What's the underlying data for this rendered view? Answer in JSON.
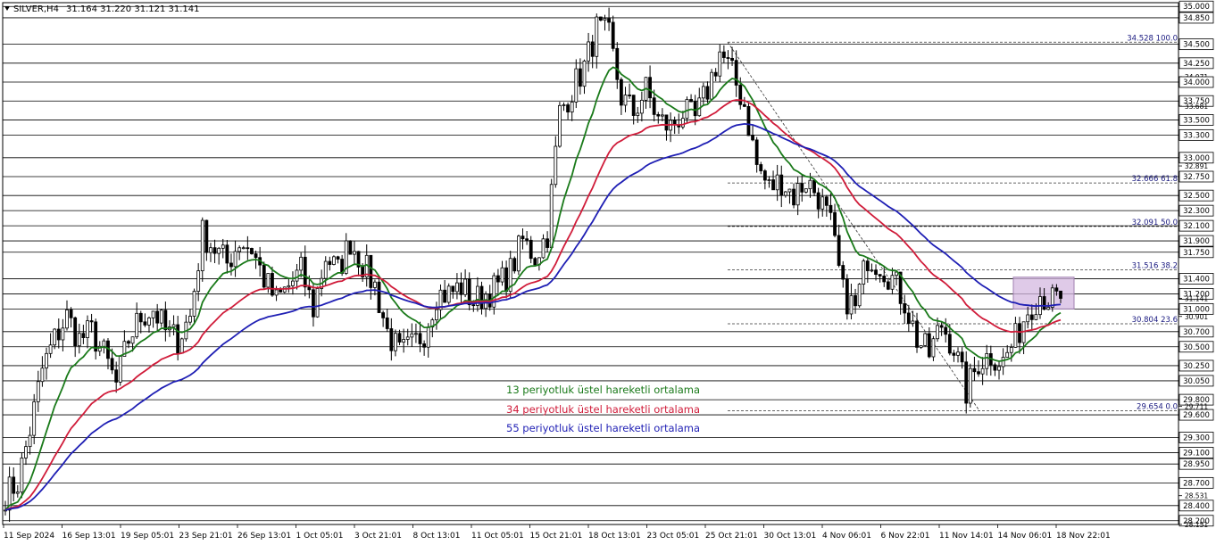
{
  "header": {
    "symbol": "SILVER,H4",
    "ohlc": "31.164 31.220 31.121 31.141"
  },
  "chart_data": {
    "type": "candlestick",
    "symbol": "SILVER",
    "timeframe": "H4",
    "price_range": [
      28.15,
      35.05
    ],
    "price_levels": [
      35.0,
      34.85,
      34.5,
      34.25,
      34.0,
      33.75,
      33.5,
      33.3,
      33.0,
      32.75,
      32.5,
      32.3,
      32.1,
      31.9,
      31.75,
      31.4,
      31.2,
      31.0,
      30.7,
      30.5,
      30.25,
      30.05,
      29.8,
      29.6,
      29.3,
      29.1,
      28.95,
      28.7,
      28.4,
      28.2
    ],
    "price_scale_labels": [
      {
        "v": 35.0,
        "t": "35.000",
        "box": true
      },
      {
        "v": 34.85,
        "t": "34.850",
        "box": true
      },
      {
        "v": 34.5,
        "t": "34.500",
        "box": true
      },
      {
        "v": 34.25,
        "t": "34.250",
        "box": true
      },
      {
        "v": 34.071,
        "t": "34.071",
        "box": false
      },
      {
        "v": 34.0,
        "t": "34.000",
        "box": true
      },
      {
        "v": 33.75,
        "t": "33.750",
        "box": true
      },
      {
        "v": 33.681,
        "t": "33.681",
        "box": false
      },
      {
        "v": 33.5,
        "t": "33.500",
        "box": true
      },
      {
        "v": 33.3,
        "t": "33.300",
        "box": true
      },
      {
        "v": 33.0,
        "t": "33.000",
        "box": true
      },
      {
        "v": 32.891,
        "t": "32.891",
        "box": false
      },
      {
        "v": 32.75,
        "t": "32.750",
        "box": true
      },
      {
        "v": 32.5,
        "t": "32.500",
        "box": true
      },
      {
        "v": 32.3,
        "t": "32.300",
        "box": true
      },
      {
        "v": 32.1,
        "t": "32.100",
        "box": true
      },
      {
        "v": 31.9,
        "t": "31.900",
        "box": true
      },
      {
        "v": 31.75,
        "t": "31.750",
        "box": true
      },
      {
        "v": 31.4,
        "t": "31.400",
        "box": true
      },
      {
        "v": 31.2,
        "t": "31.200",
        "box": true
      },
      {
        "v": 31.141,
        "t": "31.141",
        "box": false
      },
      {
        "v": 31.0,
        "t": "31.000",
        "box": true
      },
      {
        "v": 30.901,
        "t": "30.901",
        "box": false
      },
      {
        "v": 30.7,
        "t": "30.700",
        "box": true
      },
      {
        "v": 30.5,
        "t": "30.500",
        "box": true
      },
      {
        "v": 30.25,
        "t": "30.250",
        "box": true
      },
      {
        "v": 30.05,
        "t": "30.050",
        "box": true
      },
      {
        "v": 29.8,
        "t": "29.800",
        "box": true
      },
      {
        "v": 29.711,
        "t": "29.711",
        "box": false
      },
      {
        "v": 29.6,
        "t": "29.600",
        "box": true
      },
      {
        "v": 29.3,
        "t": "29.300",
        "box": true
      },
      {
        "v": 29.1,
        "t": "29.100",
        "box": true
      },
      {
        "v": 28.95,
        "t": "28.950",
        "box": true
      },
      {
        "v": 28.7,
        "t": "28.700",
        "box": true
      },
      {
        "v": 28.531,
        "t": "28.531",
        "box": false
      },
      {
        "v": 28.4,
        "t": "28.400",
        "box": true
      },
      {
        "v": 28.2,
        "t": "28.200",
        "box": true
      },
      {
        "v": 28.151,
        "t": "28.151",
        "box": false
      }
    ],
    "time_labels": [
      "11 Sep 2024",
      "16 Sep 13:01",
      "19 Sep 05:01",
      "23 Sep 21:01",
      "26 Sep 13:01",
      "1 Oct 05:01",
      "3 Oct 21:01",
      "8 Oct 13:01",
      "11 Oct 05:01",
      "15 Oct 21:01",
      "18 Oct 13:01",
      "23 Oct 05:01",
      "25 Oct 21:01",
      "30 Oct 13:01",
      "4 Nov 06:01",
      "6 Nov 22:01",
      "11 Nov 14:01",
      "14 Nov 06:01",
      "18 Nov 22:01"
    ],
    "price_path": [
      [
        0,
        28.55
      ],
      [
        3,
        28.7
      ],
      [
        6,
        29.4
      ],
      [
        9,
        30.2
      ],
      [
        12,
        30.6
      ],
      [
        15,
        30.9
      ],
      [
        18,
        30.6
      ],
      [
        21,
        30.7
      ],
      [
        24,
        30.4
      ],
      [
        27,
        30.0
      ],
      [
        30,
        30.6
      ],
      [
        33,
        30.9
      ],
      [
        36,
        31.0
      ],
      [
        39,
        30.7
      ],
      [
        42,
        30.6
      ],
      [
        45,
        30.9
      ],
      [
        48,
        32.0
      ],
      [
        51,
        31.8
      ],
      [
        54,
        31.6
      ],
      [
        57,
        31.9
      ],
      [
        60,
        31.8
      ],
      [
        63,
        31.4
      ],
      [
        66,
        31.1
      ],
      [
        69,
        31.3
      ],
      [
        72,
        31.5
      ],
      [
        75,
        31.0
      ],
      [
        78,
        31.7
      ],
      [
        81,
        31.5
      ],
      [
        84,
        31.9
      ],
      [
        87,
        31.6
      ],
      [
        90,
        31.3
      ],
      [
        93,
        30.7
      ],
      [
        96,
        30.4
      ],
      [
        99,
        30.5
      ],
      [
        102,
        30.7
      ],
      [
        105,
        31.2
      ],
      [
        108,
        31.2
      ],
      [
        111,
        31.3
      ],
      [
        114,
        31.1
      ],
      [
        117,
        31.2
      ],
      [
        120,
        31.3
      ],
      [
        123,
        31.5
      ],
      [
        126,
        31.9
      ],
      [
        129,
        31.7
      ],
      [
        132,
        32.0
      ],
      [
        135,
        33.6
      ],
      [
        138,
        33.9
      ],
      [
        141,
        34.2
      ],
      [
        144,
        34.7
      ],
      [
        147,
        34.6
      ],
      [
        150,
        33.8
      ],
      [
        153,
        33.6
      ],
      [
        156,
        33.9
      ],
      [
        159,
        33.5
      ],
      [
        162,
        33.4
      ],
      [
        165,
        33.6
      ],
      [
        168,
        33.5
      ],
      [
        171,
        33.9
      ],
      [
        174,
        34.4
      ],
      [
        177,
        34.1
      ],
      [
        180,
        33.7
      ],
      [
        183,
        32.9
      ],
      [
        186,
        32.6
      ],
      [
        189,
        32.7
      ],
      [
        192,
        32.5
      ],
      [
        195,
        32.7
      ],
      [
        198,
        32.5
      ],
      [
        201,
        32.1
      ],
      [
        204,
        31.2
      ],
      [
        207,
        31.0
      ],
      [
        210,
        31.7
      ],
      [
        213,
        31.6
      ],
      [
        216,
        31.4
      ],
      [
        219,
        31.1
      ],
      [
        222,
        30.6
      ],
      [
        225,
        30.4
      ],
      [
        228,
        30.8
      ],
      [
        231,
        30.5
      ],
      [
        234,
        29.9
      ],
      [
        237,
        30.3
      ],
      [
        240,
        30.4
      ],
      [
        243,
        30.3
      ],
      [
        246,
        30.6
      ],
      [
        249,
        31.0
      ],
      [
        252,
        31.2
      ],
      [
        255,
        31.1
      ],
      [
        257,
        31.14
      ]
    ],
    "ema_series": [
      {
        "name": "13 periyotluk üstel hareketli ortalama",
        "period": 13,
        "color": "#1a7a1a"
      },
      {
        "name": "34 periyotluk üstel hareketli ortalama",
        "period": 34,
        "color": "#d01c3a"
      },
      {
        "name": "55 periyotluk üstel hareketli ortalama",
        "period": 55,
        "color": "#1f1fb4"
      }
    ],
    "fibonacci": {
      "levels": [
        {
          "price": 34.528,
          "text": "34.528 100.0"
        },
        {
          "price": 32.666,
          "text": "32.666 61.8"
        },
        {
          "price": 32.091,
          "text": "32.091 50.0"
        },
        {
          "price": 31.516,
          "text": "31.516 38.2"
        },
        {
          "price": 30.804,
          "text": "30.804 23.6"
        },
        {
          "price": 29.654,
          "text": "29.654 0.0"
        }
      ],
      "anchor_high_price": 34.528,
      "anchor_low_price": 29.654
    },
    "highlight_zone": {
      "price_low": 31.0,
      "price_high": 31.42,
      "color": "#d4b8e0"
    }
  },
  "legend": {
    "ema13": "13 periyotluk üstel hareketli ortalama",
    "ema34": "34 periyotluk üstel hareketli ortalama",
    "ema55": "55 periyotluk üstel hareketli ortalama"
  }
}
